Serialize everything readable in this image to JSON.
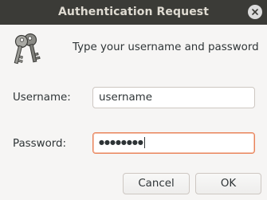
{
  "window": {
    "title": "Authentication Request"
  },
  "dialog": {
    "prompt": "Type your username and password",
    "icon": "keys-icon",
    "username_label": "Username:",
    "username_value": "username",
    "password_label": "Password:",
    "password_masked": "●●●●●●●●",
    "cancel_label": "Cancel",
    "ok_label": "OK"
  },
  "colors": {
    "titlebar": "#3b3b37",
    "focus_border": "#e9835a",
    "background": "#f6f5f4"
  }
}
